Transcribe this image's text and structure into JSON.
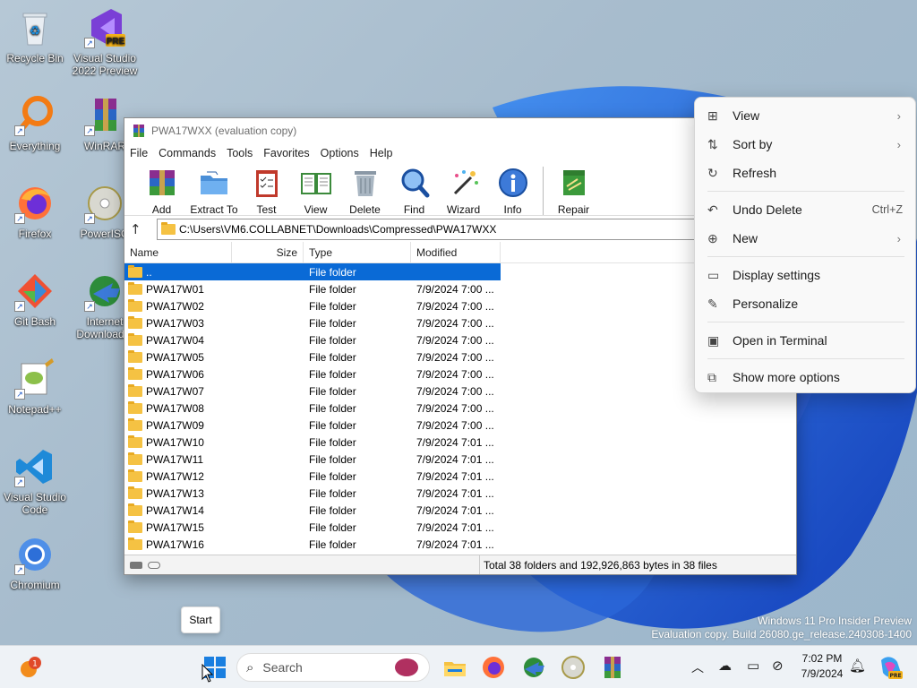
{
  "desktop": {
    "icons": [
      {
        "label": "Recycle Bin",
        "icon": "recycle-bin-icon"
      },
      {
        "label": "Visual Studio 2022 Preview",
        "icon": "visual-studio-preview-icon",
        "badge": "PRE"
      },
      {
        "label": "Everything",
        "icon": "everything-search-icon"
      },
      {
        "label": "WinRAR",
        "icon": "winrar-icon"
      },
      {
        "label": "Firefox",
        "icon": "firefox-icon"
      },
      {
        "label": "PowerISO",
        "icon": "poweriso-icon"
      },
      {
        "label": "Git Bash",
        "icon": "git-bash-icon"
      },
      {
        "label": "Internet Download...",
        "icon": "idm-icon"
      },
      {
        "label": "Notepad++",
        "icon": "notepad-plus-plus-icon"
      },
      {
        "label": "Visual Studio Code",
        "icon": "vscode-icon"
      },
      {
        "label": "Chromium",
        "icon": "chromium-icon"
      }
    ]
  },
  "winrar": {
    "title": "PWA17WXX (evaluation copy)",
    "menu": [
      "File",
      "Commands",
      "Tools",
      "Favorites",
      "Options",
      "Help"
    ],
    "toolbar": [
      {
        "label": "Add",
        "icon": "add-archive-icon"
      },
      {
        "label": "Extract To",
        "icon": "extract-folder-icon"
      },
      {
        "label": "Test",
        "icon": "test-clipboard-icon"
      },
      {
        "label": "View",
        "icon": "view-book-icon"
      },
      {
        "label": "Delete",
        "icon": "trash-bin-icon"
      },
      {
        "label": "Find",
        "icon": "magnifier-icon"
      },
      {
        "label": "Wizard",
        "icon": "wizard-wand-icon"
      },
      {
        "label": "Info",
        "icon": "info-icon"
      },
      {
        "label": "Repair",
        "icon": "repair-box-icon"
      }
    ],
    "address": "C:\\Users\\VM6.COLLABNET\\Downloads\\Compressed\\PWA17WXX",
    "columns": {
      "name": "Name",
      "size": "Size",
      "type": "Type",
      "modified": "Modified"
    },
    "rows": [
      {
        "name": "..",
        "size": "",
        "type": "File folder",
        "modified": "",
        "selected": true
      },
      {
        "name": "PWA17W01",
        "size": "",
        "type": "File folder",
        "modified": "7/9/2024 7:00 ..."
      },
      {
        "name": "PWA17W02",
        "size": "",
        "type": "File folder",
        "modified": "7/9/2024 7:00 ..."
      },
      {
        "name": "PWA17W03",
        "size": "",
        "type": "File folder",
        "modified": "7/9/2024 7:00 ..."
      },
      {
        "name": "PWA17W04",
        "size": "",
        "type": "File folder",
        "modified": "7/9/2024 7:00 ..."
      },
      {
        "name": "PWA17W05",
        "size": "",
        "type": "File folder",
        "modified": "7/9/2024 7:00 ..."
      },
      {
        "name": "PWA17W06",
        "size": "",
        "type": "File folder",
        "modified": "7/9/2024 7:00 ..."
      },
      {
        "name": "PWA17W07",
        "size": "",
        "type": "File folder",
        "modified": "7/9/2024 7:00 ..."
      },
      {
        "name": "PWA17W08",
        "size": "",
        "type": "File folder",
        "modified": "7/9/2024 7:00 ..."
      },
      {
        "name": "PWA17W09",
        "size": "",
        "type": "File folder",
        "modified": "7/9/2024 7:00 ..."
      },
      {
        "name": "PWA17W10",
        "size": "",
        "type": "File folder",
        "modified": "7/9/2024 7:01 ..."
      },
      {
        "name": "PWA17W11",
        "size": "",
        "type": "File folder",
        "modified": "7/9/2024 7:01 ..."
      },
      {
        "name": "PWA17W12",
        "size": "",
        "type": "File folder",
        "modified": "7/9/2024 7:01 ..."
      },
      {
        "name": "PWA17W13",
        "size": "",
        "type": "File folder",
        "modified": "7/9/2024 7:01 ..."
      },
      {
        "name": "PWA17W14",
        "size": "",
        "type": "File folder",
        "modified": "7/9/2024 7:01 ..."
      },
      {
        "name": "PWA17W15",
        "size": "",
        "type": "File folder",
        "modified": "7/9/2024 7:01 ..."
      },
      {
        "name": "PWA17W16",
        "size": "",
        "type": "File folder",
        "modified": "7/9/2024 7:01 ..."
      }
    ],
    "status": "Total 38 folders and 192,926,863 bytes in 38 files"
  },
  "context_menu": {
    "items": [
      {
        "label": "View",
        "icon": "grid-view-icon",
        "submenu": true
      },
      {
        "label": "Sort by",
        "icon": "sort-icon",
        "submenu": true
      },
      {
        "label": "Refresh",
        "icon": "refresh-icon"
      },
      {
        "label": "Undo Delete",
        "icon": "undo-icon",
        "shortcut": "Ctrl+Z"
      },
      {
        "label": "New",
        "icon": "new-plus-icon",
        "submenu": true
      },
      {
        "label": "Display settings",
        "icon": "display-icon"
      },
      {
        "label": "Personalize",
        "icon": "pen-icon"
      },
      {
        "label": "Open in Terminal",
        "icon": "terminal-icon"
      },
      {
        "label": "Show more options",
        "icon": "more-options-icon"
      }
    ]
  },
  "watermark": {
    "line1": "Windows 11 Pro Insider Preview",
    "line2": "Evaluation copy. Build 26080.ge_release.240308-1400"
  },
  "tooltip": "Start",
  "taskbar": {
    "notification_count": "1",
    "search_placeholder": "Search",
    "time": "7:02 PM",
    "date": "7/9/2024",
    "copilot_badge": "PRE"
  },
  "colors": {
    "selection": "#0a6ad6",
    "folder": "#f5c243",
    "desktop_bloom": "#1559d6"
  }
}
